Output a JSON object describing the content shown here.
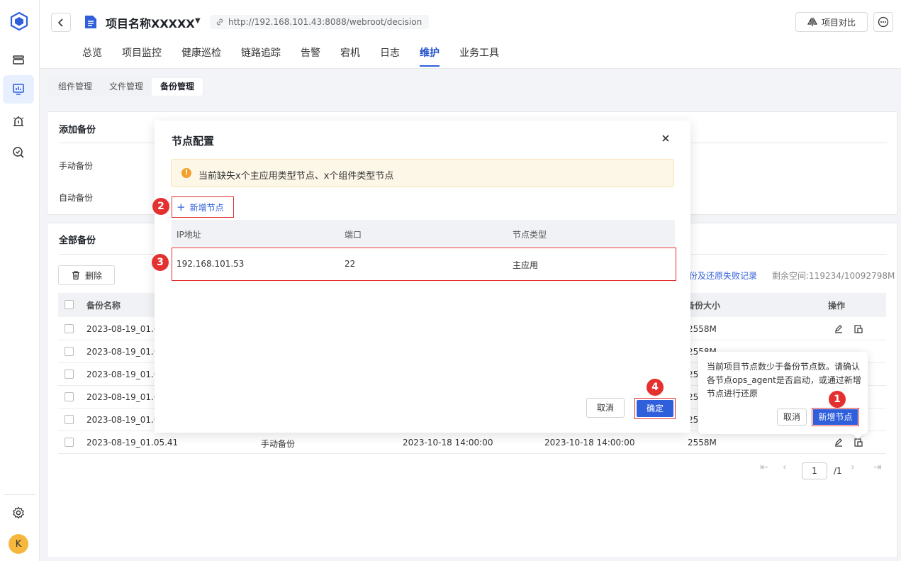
{
  "header": {
    "project_title": "项目名称XXXXX",
    "url": "http://192.168.101.43:8088/webroot/decision",
    "compare_label": "项目对比"
  },
  "tabs": [
    "总览",
    "项目监控",
    "健康巡检",
    "链路追踪",
    "告警",
    "宕机",
    "日志",
    "维护",
    "业务工具"
  ],
  "active_tab": "维护",
  "subtabs": [
    "组件管理",
    "文件管理",
    "备份管理"
  ],
  "active_subtab": "备份管理",
  "avatar_letter": "K",
  "add_backup": {
    "title": "添加备份",
    "manual_label": "手动备份",
    "auto_label": "自动备份"
  },
  "all_backup": {
    "title": "全部备份",
    "delete_label": "删除",
    "fail_records_link": "备份及还原失败记录",
    "remaining_space": "剩余空间:119234/10092798M",
    "columns": {
      "name": "备份名称",
      "size": "备份大小",
      "ops": "操作"
    },
    "rows": [
      {
        "name": "2023-08-19_01.0",
        "size": "2558M"
      },
      {
        "name": "2023-08-19_01.0",
        "size": "2558M"
      },
      {
        "name": "2023-08-19_01.0",
        "size": "255"
      },
      {
        "name": "2023-08-19_01.0",
        "size": "255"
      },
      {
        "name": "2023-08-19_01.0",
        "size": "255"
      },
      {
        "name": "2023-08-19_01.05.41",
        "type": "手动备份",
        "start": "2023-10-18 14:00:00",
        "end": "2023-10-18 14:00:00",
        "size": "2558M"
      }
    ],
    "pagination": {
      "current": "1",
      "total": "/1"
    }
  },
  "modal": {
    "title": "节点配置",
    "alert": "当前缺失x个主应用类型节点、x个组件类型节点",
    "add_node_label": "新增节点",
    "columns": {
      "ip": "IP地址",
      "port": "端口",
      "type": "节点类型"
    },
    "row": {
      "ip": "192.168.101.53",
      "port": "22",
      "type": "主应用"
    },
    "cancel_label": "取消",
    "ok_label": "确定"
  },
  "popover": {
    "text": "当前项目节点数少于备份节点数。请确认各节点ops_agent是否启动，或通过新增节点进行还原",
    "cancel_label": "取消",
    "ok_label": "新增节点"
  },
  "badges": {
    "one": "1",
    "two": "2",
    "three": "3",
    "four": "4"
  },
  "colors": {
    "primary": "#2f5fdb",
    "highlight": "#e03030",
    "warning": "#f0a12e"
  }
}
